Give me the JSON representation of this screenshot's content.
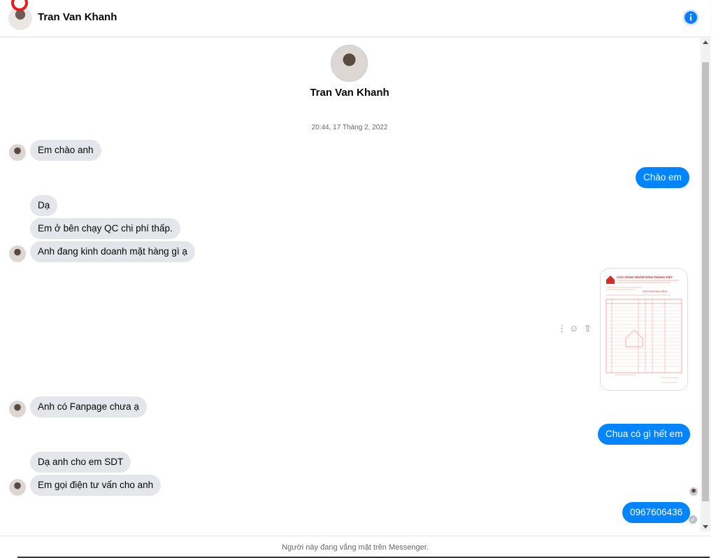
{
  "header": {
    "name": "Tran Van Khanh"
  },
  "profile": {
    "name": "Tran Van Khanh"
  },
  "timestamp": "20:44, 17 Tháng 2, 2022",
  "messages": {
    "m1": "Em chào anh",
    "m2": "Chào em",
    "m3": "Dạ",
    "m4": "Em ở bên chạy QC chi phí thấp.",
    "m5": "Anh đang kinh doanh mặt hàng gì ạ",
    "m6": "Anh có Fanpage chưa ạ",
    "m7": "Chua có gì hết em",
    "m8": "Dạ anh cho em SDT",
    "m9": "Em gọi điện tư vấn cho anh",
    "m10": "0967606436"
  },
  "image_message": {
    "title": "CỬA HÀNG NHÔM KÍNH THÀNH VIỆT",
    "subtitle": "HÓA ĐƠN BÁN HÀNG"
  },
  "footer": {
    "status": "Người này đang vắng mặt trên Messenger."
  },
  "colors": {
    "outgoing": "#0084ff",
    "incoming": "#e4e6eb"
  },
  "icons": {
    "info": "info-icon",
    "more": "more-icon",
    "react": "smiley-icon",
    "share": "share-icon"
  }
}
